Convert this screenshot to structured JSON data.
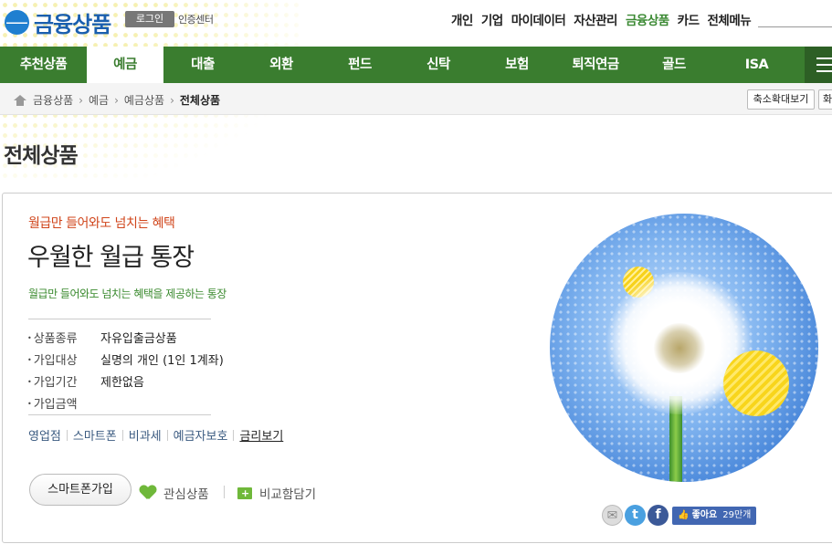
{
  "header": {
    "logo_text": "금융상품",
    "login_label": "로그인",
    "cert_label": "인증센터",
    "top_menu": [
      "개인",
      "기업",
      "마이데이터",
      "자산관리",
      "금융상품",
      "카드",
      "전체메뉴"
    ],
    "top_menu_active": 4
  },
  "nav": {
    "items": [
      "추천상품",
      "예금",
      "대출",
      "외환",
      "펀드",
      "신탁",
      "보험",
      "퇴직연금",
      "골드",
      "ISA"
    ],
    "active": 1
  },
  "breadcrumb": {
    "items": [
      "금융상품",
      "예금",
      "예금상품"
    ],
    "current": "전체상품",
    "zoom_label": "축소확대보기",
    "zoom2_label": "화"
  },
  "page_title": "전체상품",
  "product": {
    "eyebrow": "월급만 들어와도 넘치는 혜택",
    "name": "우월한 월급 통장",
    "description": "월급만 들어와도 넘치는 혜택을 제공하는 통장",
    "specs": [
      {
        "label": "상품종류",
        "value": "자유입출금상품"
      },
      {
        "label": "가입대상",
        "value": "실명의 개인 (1인 1계좌)"
      },
      {
        "label": "가입기간",
        "value": "제한없음"
      },
      {
        "label": "가입금액",
        "value": ""
      }
    ],
    "links": [
      "영업점",
      "스마트폰",
      "비과세",
      "예금자보호",
      "금리보기"
    ],
    "smart_join_label": "스마트폰가입",
    "interest_label": "관심상품",
    "compare_label": "비교함담기"
  },
  "share": {
    "like_label": "좋아요",
    "like_count": "29만개"
  },
  "colors": {
    "brand_green": "#3a7d2f",
    "logo_blue": "#1a5fae",
    "accent_orange": "#d0451b"
  },
  "icons": [
    "home-icon",
    "heart-icon",
    "folder-add-icon",
    "mail-icon",
    "twitter-icon",
    "facebook-icon",
    "thumbs-up-icon",
    "hamburger-icon"
  ]
}
